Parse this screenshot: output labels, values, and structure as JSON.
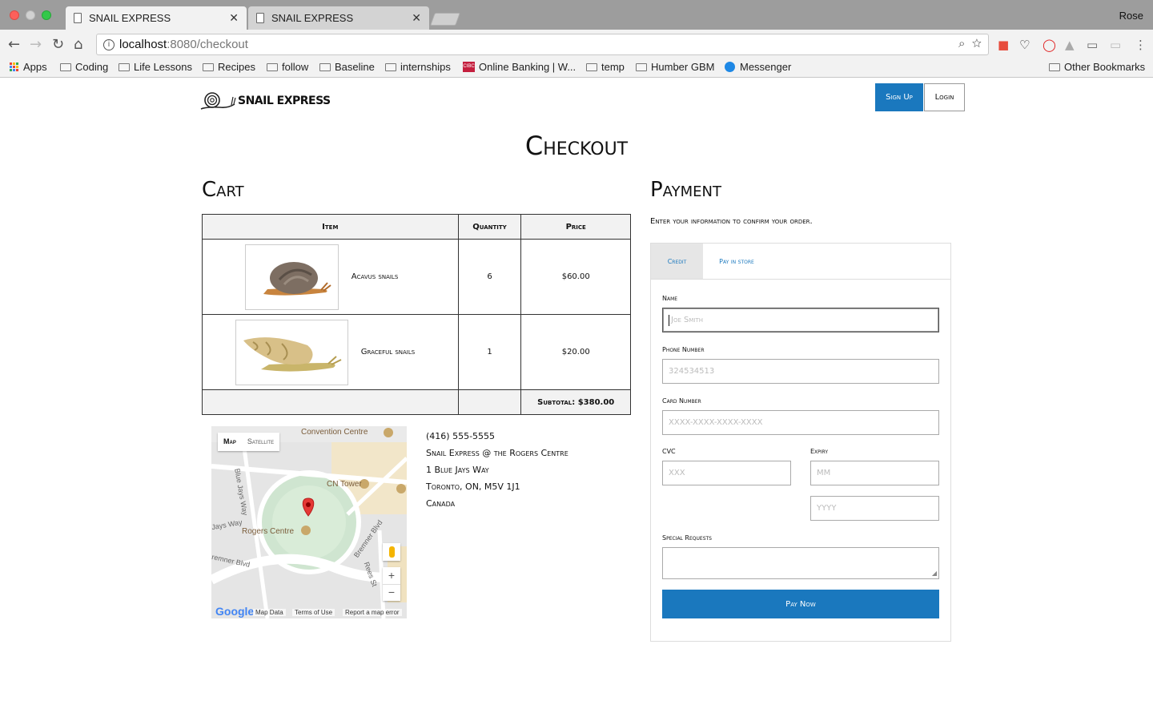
{
  "browser": {
    "tabs": [
      {
        "title": "SNAIL EXPRESS"
      },
      {
        "title": "SNAIL EXPRESS"
      }
    ],
    "profile_name": "Rose",
    "url_host": "localhost",
    "url_path": ":8080/checkout",
    "bookmarks": [
      {
        "label": "Apps",
        "icon": "apps-grid-icon"
      },
      {
        "label": "Coding",
        "icon": "folder-icon"
      },
      {
        "label": "Life Lessons",
        "icon": "folder-icon"
      },
      {
        "label": "Recipes",
        "icon": "folder-icon"
      },
      {
        "label": "follow",
        "icon": "folder-icon"
      },
      {
        "label": "Baseline",
        "icon": "folder-icon"
      },
      {
        "label": "internships",
        "icon": "folder-icon"
      },
      {
        "label": "Online Banking | W...",
        "icon": "cibc-icon"
      },
      {
        "label": "temp",
        "icon": "folder-icon"
      },
      {
        "label": "Humber GBM",
        "icon": "folder-icon"
      },
      {
        "label": "Messenger",
        "icon": "messenger-icon"
      },
      {
        "label": "Other Bookmarks",
        "icon": "folder-icon"
      }
    ]
  },
  "site": {
    "logo_text": "SNAIL EXPRESS",
    "signup_label": "Sign Up",
    "login_label": "Login",
    "accent_color": "#1a78be"
  },
  "checkout": {
    "title": "Checkout",
    "cart": {
      "title": "Cart",
      "headers": [
        "Item",
        "Quantity",
        "Price"
      ],
      "rows": [
        {
          "name": "Acavus snails",
          "quantity": "6",
          "price": "$60.00"
        },
        {
          "name": "Graceful snails",
          "quantity": "1",
          "price": "$20.00"
        }
      ],
      "subtotal": "Subtotal: $380.00"
    },
    "map": {
      "map_tab": "Map",
      "satellite_tab": "Satellite",
      "labels": [
        "Convention Centre",
        "CN Tower",
        "Rogers Centre",
        "Blue Jays Way",
        "Bremner Blvd",
        "Rees St",
        "Jays Way",
        "remner Blvd"
      ],
      "google": "Google",
      "footer": [
        "Map Data",
        "Terms of Use",
        "Report a map error"
      ]
    },
    "address": {
      "phone": "(416) 555-5555",
      "line1": "Snail Express @ the Rogers Centre",
      "line2": "1 Blue Jays Way",
      "line3": "Toronto, ON, M5V 1J1",
      "line4": "Canada"
    },
    "payment": {
      "title": "Payment",
      "intro": "Enter your information to confirm your order.",
      "tabs": [
        "Credit",
        "Pay in store"
      ],
      "fields": {
        "name_label": "Name",
        "name_placeholder": "Joe Smith",
        "phone_label": "Phone Number",
        "phone_placeholder": "324534513",
        "card_label": "Card Number",
        "card_placeholder": "XXXX-XXXX-XXXX-XXXX",
        "cvc_label": "CVC",
        "cvc_placeholder": "XXX",
        "expiry_label": "Expiry",
        "month_placeholder": "MM",
        "year_placeholder": "YYYY",
        "requests_label": "Special Requests"
      },
      "submit_label": "Pay Now"
    }
  }
}
